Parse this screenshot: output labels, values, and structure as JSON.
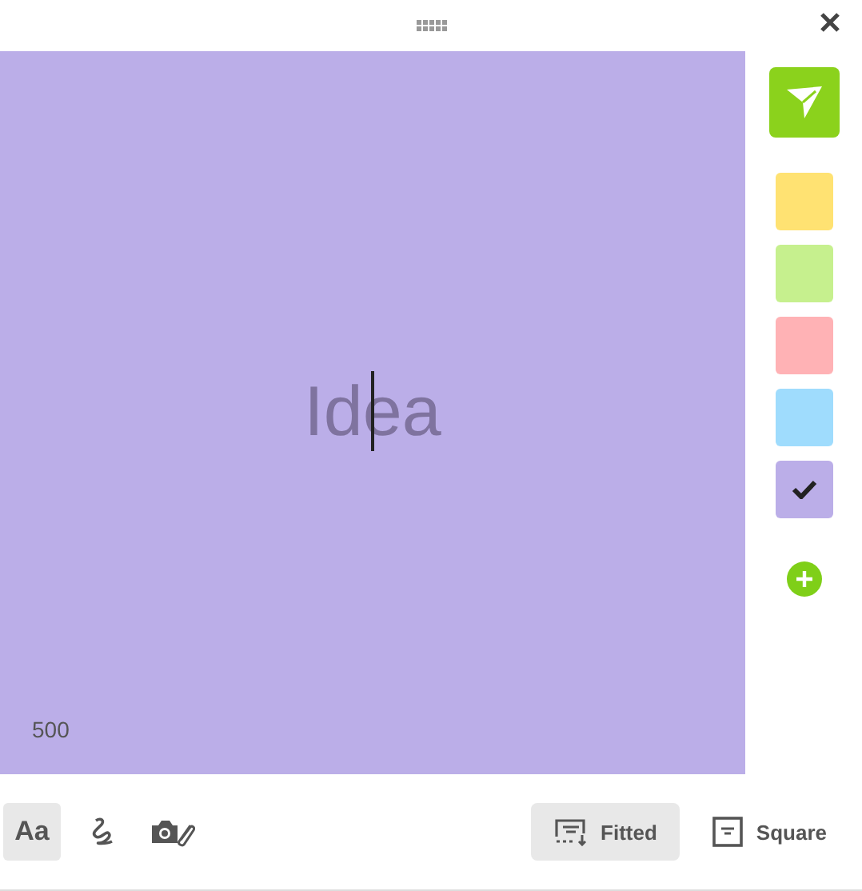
{
  "note": {
    "text": "Idea",
    "counter": "500"
  },
  "colors": [
    {
      "color": "#ffe272",
      "selected": false
    },
    {
      "color": "#c6f08e",
      "selected": false
    },
    {
      "color": "#ffb2b5",
      "selected": false
    },
    {
      "color": "#9fdcfd",
      "selected": false
    },
    {
      "color": "#bbaee8",
      "selected": true
    }
  ],
  "tools": [
    {
      "kind": "text",
      "label": "Aa",
      "selected": true
    },
    {
      "kind": "draw",
      "selected": false
    },
    {
      "kind": "photo",
      "selected": false
    }
  ],
  "views": [
    {
      "kind": "fitted",
      "label": "Fitted",
      "selected": true
    },
    {
      "kind": "square",
      "label": "Square",
      "selected": false
    }
  ]
}
